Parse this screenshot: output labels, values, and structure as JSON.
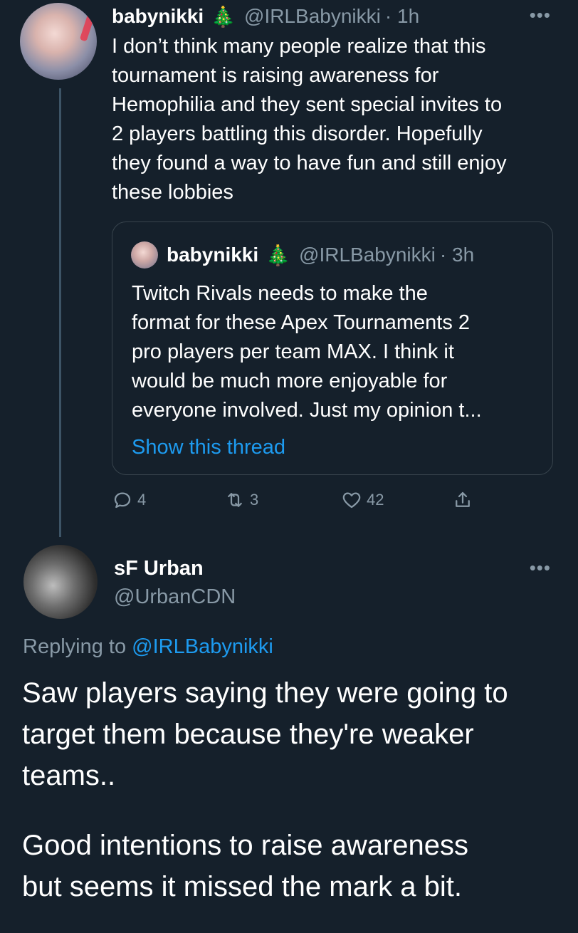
{
  "tweet": {
    "author_name": "babynikki",
    "author_emoji": "🎄",
    "author_handle": "@IRLBabynikki",
    "time": "· 1h",
    "more": "•••",
    "text": "I don’t think many people realize that this\ntournament is raising awareness for\nHemophilia and they sent special invites to\n2 players battling this disorder. Hopefully\nthey found a way to have fun and still enjoy\nthese lobbies",
    "quote": {
      "author_name": "babynikki",
      "author_emoji": "🎄",
      "author_handle": "@IRLBabynikki",
      "time": "· 3h",
      "text": "Twitch Rivals needs to make the\nformat for these Apex Tournaments 2\npro players per team MAX. I think it\nwould be much more enjoyable for\neveryone involved. Just my opinion t...",
      "show_thread": "Show this thread"
    },
    "actions": {
      "replies": "4",
      "retweets": "3",
      "likes": "42"
    }
  },
  "reply": {
    "author_name": "sF Urban",
    "author_handle": "@UrbanCDN",
    "more": "•••",
    "replying_prefix": "Replying to ",
    "replying_handle": "@IRLBabynikki",
    "paragraph_1": "Saw players saying they were going to\ntarget them because they're weaker\nteams..",
    "paragraph_2": "Good intentions to raise awareness\nbut seems it missed the mark a bit."
  },
  "colors": {
    "background": "#15202b",
    "text": "#ffffff",
    "muted": "#8899a6",
    "link": "#1d9bf0",
    "border": "#38444d"
  }
}
